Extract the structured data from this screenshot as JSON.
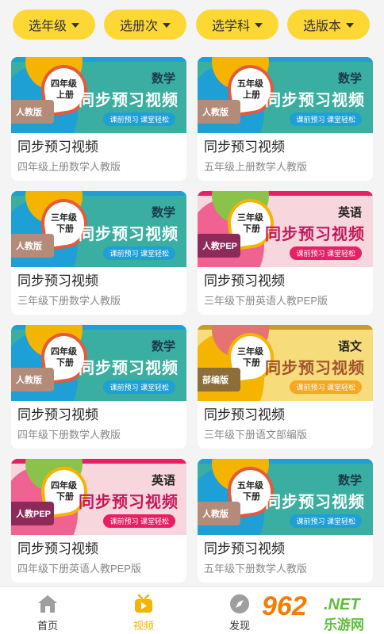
{
  "filters": [
    {
      "label": "选年级"
    },
    {
      "label": "选册次"
    },
    {
      "label": "选学科"
    },
    {
      "label": "选版本"
    }
  ],
  "common": {
    "main_title": "同步预习视频",
    "slogan": "课前预习 课堂轻松"
  },
  "cards": [
    {
      "grade": "四年级",
      "volume": "上册",
      "subject": "数学",
      "edition": "人教版",
      "title": "同步预习视频",
      "subtitle": "四年级上册数学人教版",
      "theme": "math"
    },
    {
      "grade": "五年级",
      "volume": "上册",
      "subject": "数学",
      "edition": "人教版",
      "title": "同步预习视频",
      "subtitle": "五年级上册数学人教版",
      "theme": "math"
    },
    {
      "grade": "三年级",
      "volume": "下册",
      "subject": "数学",
      "edition": "人教版",
      "title": "同步预习视频",
      "subtitle": "三年级下册数学人教版",
      "theme": "math"
    },
    {
      "grade": "三年级",
      "volume": "下册",
      "subject": "英语",
      "edition": "人教PEP",
      "title": "同步预习视频",
      "subtitle": "三年级下册英语人教PEP版",
      "theme": "english"
    },
    {
      "grade": "四年级",
      "volume": "下册",
      "subject": "数学",
      "edition": "人教版",
      "title": "同步预习视频",
      "subtitle": "四年级下册数学人教版",
      "theme": "math"
    },
    {
      "grade": "三年级",
      "volume": "下册",
      "subject": "语文",
      "edition": "部编版",
      "title": "同步预习视频",
      "subtitle": "三年级下册语文部编版",
      "theme": "chinese"
    },
    {
      "grade": "四年级",
      "volume": "下册",
      "subject": "英语",
      "edition": "人教PEP",
      "title": "同步预习视频",
      "subtitle": "四年级下册英语人教PEP版",
      "theme": "english"
    },
    {
      "grade": "五年级",
      "volume": "下册",
      "subject": "数学",
      "edition": "人教版",
      "title": "同步预习视频",
      "subtitle": "五年级下册数学人教版",
      "theme": "math"
    }
  ],
  "tabs": [
    {
      "label": "首页",
      "icon": "home-icon",
      "active": false
    },
    {
      "label": "视频",
      "icon": "video-icon",
      "active": true
    },
    {
      "label": "发现",
      "icon": "compass-icon",
      "active": false
    }
  ],
  "watermark": {
    "number": "962",
    "net": ".NET",
    "site": "乐游网"
  },
  "colors": {
    "filter_bg": "#fdd835",
    "active_tab": "#f4b400",
    "math_bg": "#3aaea0",
    "math_title": "#ffffff",
    "math_blob": "#1e9fd6",
    "english_bg": "#f7d6dd",
    "english_title": "#c2185b",
    "chinese_bg": "#f6dc7a",
    "chinese_title": "#a0522d"
  }
}
